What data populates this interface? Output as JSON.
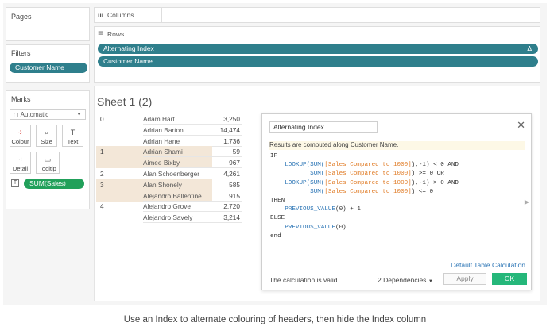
{
  "panels": {
    "pages": {
      "title": "Pages"
    },
    "filters": {
      "title": "Filters",
      "pills": [
        "Customer Name"
      ]
    },
    "marks": {
      "title": "Marks",
      "type": "Automatic",
      "buttons": [
        "Colour",
        "Size",
        "Text",
        "Detail",
        "Tooltip"
      ],
      "field_pill": "SUM(Sales)"
    }
  },
  "shelves": {
    "columns": {
      "label": "Columns"
    },
    "rows": {
      "label": "Rows",
      "pills": [
        "Alternating Index",
        "Customer Name"
      ],
      "delta": "Δ"
    }
  },
  "sheet": {
    "title": "Sheet 1 (2)",
    "rows": [
      {
        "index": "0",
        "name": "Adam Hart",
        "value": "3,250",
        "highlight": false
      },
      {
        "index": "",
        "name": "Adrian Barton",
        "value": "14,474",
        "highlight": false
      },
      {
        "index": "",
        "name": "Adrian Hane",
        "value": "1,736",
        "highlight": false
      },
      {
        "index": "1",
        "name": "Adrian Shami",
        "value": "59",
        "highlight": true
      },
      {
        "index": "",
        "name": "Aimee Bixby",
        "value": "967",
        "highlight": true
      },
      {
        "index": "2",
        "name": "Alan Schoenberger",
        "value": "4,261",
        "highlight": false
      },
      {
        "index": "3",
        "name": "Alan Shonely",
        "value": "585",
        "highlight": true
      },
      {
        "index": "",
        "name": "Alejandro Ballentine",
        "value": "915",
        "highlight": true
      },
      {
        "index": "4",
        "name": "Alejandro Grove",
        "value": "2,720",
        "highlight": false
      },
      {
        "index": "",
        "name": "Alejandro Savely",
        "value": "3,214",
        "highlight": false
      }
    ]
  },
  "dialog": {
    "name_value": "Alternating Index",
    "note": "Results are computed along Customer Name.",
    "code": {
      "l1": "IF",
      "l2_fn": "LOOKUP(SUM(",
      "l2_fld": "[Sales Compared to 1000]",
      "l2_end": "),-1) < 0 AND",
      "l3_fn": "SUM(",
      "l3_fld": "[Sales Compared to 1000]",
      "l3_end": ") >= 0 OR",
      "l4_fn": "LOOKUP(SUM(",
      "l4_fld": "[Sales Compared to 1000]",
      "l4_end": "),-1) > 0 AND",
      "l5_fn": "SUM(",
      "l5_fld": "[Sales Compared to 1000]",
      "l5_end": ") <= 0",
      "l6": "THEN",
      "l7_fn": "PREVIOUS_VALUE",
      "l7_end": "(0) + 1",
      "l8": "ELSE",
      "l9_fn": "PREVIOUS_VALUE",
      "l9_end": "(0)",
      "l10": "end"
    },
    "default_table_calc": "Default Table Calculation",
    "status": "The calculation is valid.",
    "dependencies": "2 Dependencies",
    "apply_label": "Apply",
    "ok_label": "OK"
  },
  "caption": "Use an Index to alternate colouring of headers, then hide the Index column",
  "colors": {
    "pill": "#2f7f8c",
    "green": "#21a05a",
    "highlight": "#f3e7d8",
    "link": "#2a74b5"
  }
}
